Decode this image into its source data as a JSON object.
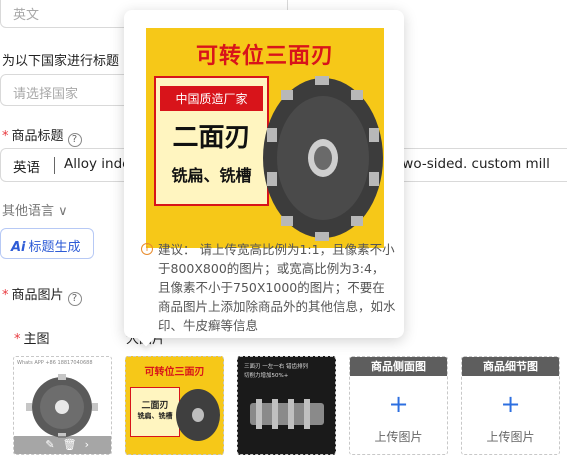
{
  "top_select": {
    "value": "英文"
  },
  "country_label": "为以下国家进行标题",
  "country_input": {
    "placeholder": "请选择国家"
  },
  "product_title": {
    "label": "商品标题",
    "help": "?",
    "lang": "英语",
    "text_part1": "Alloy inde",
    "text_part2": "two-sided.   custom mill"
  },
  "other_languages": "其他语言 ∨",
  "ai_button": {
    "icon": "Ai",
    "label": "标题生成"
  },
  "product_images": {
    "label": "商品图片",
    "help": "?",
    "main_label": "主图",
    "partial_label": "大图片",
    "slots": [
      {
        "type": "image",
        "caption": "Whats APP +86 18817040688"
      },
      {
        "type": "image",
        "caption": "可转位三面刃 二面刃 铣扁、铣槽"
      },
      {
        "type": "image",
        "caption": "三面刃 一左一右 错齿排列 切削力增加50%+"
      },
      {
        "type": "upload",
        "header": "商品侧面图",
        "button": "上传图片"
      },
      {
        "type": "upload",
        "header": "商品细节图",
        "button": "上传图片"
      }
    ]
  },
  "popover": {
    "image_title": "可转位三面刃",
    "image_tag": "中国质造厂家",
    "image_big": "二面刃",
    "image_small": "铣扁、铣槽",
    "tip": "建议： 请上传宽高比例为1:1，且像素不小于800X800的图片；或宽高比例为3:4，且像素不小于750X1000的图片；不要在商品图片上添加除商品外的其他信息，如水印、牛皮癣等信息"
  },
  "colors": {
    "accent": "#2d5bd6",
    "required": "#e8383d",
    "promo_yellow": "#f6c818",
    "promo_red": "#d8141a"
  }
}
